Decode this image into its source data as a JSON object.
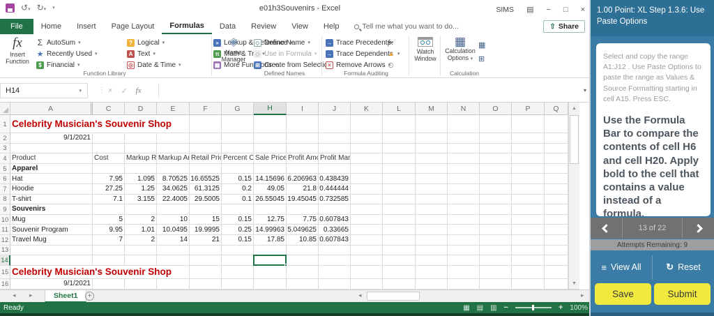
{
  "window": {
    "title": "e01h3Souvenirs - Excel",
    "user": "SIMS"
  },
  "menu": {
    "tabs": [
      "File",
      "Home",
      "Insert",
      "Page Layout",
      "Formulas",
      "Data",
      "Review",
      "View",
      "Help"
    ],
    "active_tab": "Formulas",
    "tell_me": "Tell me what you want to do...",
    "share": "Share"
  },
  "ribbon": {
    "insert_function": "Insert Function",
    "autosum": "AutoSum",
    "recently_used": "Recently Used",
    "financial": "Financial",
    "logical": "Logical",
    "text": "Text",
    "date_time": "Date & Time",
    "lookup": "Lookup & Reference",
    "math_trig": "Math & Trig",
    "more_functions": "More Functions",
    "name_manager": "Name Manager",
    "define_name": "Define Name",
    "use_in_formula": "Use in Formula",
    "create_from_selection": "Create from Selection",
    "trace_precedents": "Trace Precedents",
    "trace_dependents": "Trace Dependents",
    "remove_arrows": "Remove Arrows",
    "watch_window": "Watch Window",
    "calculation_options": "Calculation Options",
    "groups": {
      "function_library": "Function Library",
      "defined_names": "Defined Names",
      "formula_auditing": "Formula Auditing",
      "calculation": "Calculation"
    }
  },
  "formula_bar": {
    "name_box": "H14",
    "formula": ""
  },
  "sheet": {
    "columns": [
      "A",
      "C",
      "D",
      "E",
      "F",
      "G",
      "H",
      "I",
      "J",
      "K",
      "L",
      "M",
      "N",
      "O",
      "P",
      "Q"
    ],
    "selected_cell": "H14",
    "selected_column": "H",
    "selected_row": "14",
    "tab": "Sheet1",
    "rows": [
      {
        "num": "1",
        "type": "title",
        "cells": {
          "A": "Celebrity Musician's Souvenir Shop"
        }
      },
      {
        "num": "2",
        "type": "plain",
        "align_a": "right",
        "cells": {
          "A": "9/1/2021"
        }
      },
      {
        "num": "3",
        "type": "plain",
        "cells": {}
      },
      {
        "num": "4",
        "type": "colhead",
        "cells": {
          "A": "Product",
          "C": "Cost",
          "D": "Markup Rate",
          "E": "Markup Amount",
          "F": "Retail Price",
          "G": "Percent Off",
          "H": "Sale Price",
          "I": "Profit Amount",
          "J": "Profit Margin"
        }
      },
      {
        "num": "5",
        "type": "category",
        "cells": {
          "A": "Apparel"
        }
      },
      {
        "num": "6",
        "type": "data",
        "cells": {
          "A": "Hat",
          "C": "7.95",
          "D": "1.095",
          "E": "8.70525",
          "F": "16.65525",
          "G": "0.15",
          "H": "14.15696",
          "I": "6.206963",
          "J": "0.438439"
        }
      },
      {
        "num": "7",
        "type": "data",
        "cells": {
          "A": "Hoodie",
          "C": "27.25",
          "D": "1.25",
          "E": "34.0625",
          "F": "61.3125",
          "G": "0.2",
          "H": "49.05",
          "I": "21.8",
          "J": "0.444444"
        }
      },
      {
        "num": "8",
        "type": "data",
        "cells": {
          "A": "T-shirt",
          "C": "7.1",
          "D": "3.155",
          "E": "22.4005",
          "F": "29.5005",
          "G": "0.1",
          "H": "26.55045",
          "I": "19.45045",
          "J": "0.732585"
        }
      },
      {
        "num": "9",
        "type": "category",
        "cells": {
          "A": "Souvenirs"
        }
      },
      {
        "num": "10",
        "type": "data",
        "cells": {
          "A": "Mug",
          "C": "5",
          "D": "2",
          "E": "10",
          "F": "15",
          "G": "0.15",
          "H": "12.75",
          "I": "7.75",
          "J": "0.607843"
        }
      },
      {
        "num": "11",
        "type": "data",
        "cells": {
          "A": "Souvenir Program",
          "C": "9.95",
          "D": "1.01",
          "E": "10.0495",
          "F": "19.9995",
          "G": "0.25",
          "H": "14.99963",
          "I": "5.049625",
          "J": "0.33665"
        }
      },
      {
        "num": "12",
        "type": "data",
        "cells": {
          "A": "Travel Mug",
          "C": "7",
          "D": "2",
          "E": "14",
          "F": "21",
          "G": "0.15",
          "H": "17.85",
          "I": "10.85",
          "J": "0.607843"
        }
      },
      {
        "num": "13",
        "type": "plain",
        "cells": {}
      },
      {
        "num": "14",
        "type": "plain",
        "selected": "H",
        "cells": {}
      },
      {
        "num": "15",
        "type": "title",
        "cells": {
          "A": "Celebrity Musician's Souvenir Shop"
        }
      },
      {
        "num": "16",
        "type": "plain",
        "align_a": "right",
        "cells": {
          "A": "9/1/2021"
        }
      }
    ]
  },
  "status": {
    "ready": "Ready",
    "zoom": "100%"
  },
  "task_panel": {
    "header": "1.00 Point: XL Step 1.3.6: Use Paste Options",
    "instruction_1": "Select and copy the range A1:J12 . Use Paste Options to paste the range as Values & Source Formatting starting in cell A15. Press ESC.",
    "instruction_2": "Use the Formula Bar to compare the contents of cell H6 and cell H20. Apply bold to the cell that contains a value instead of a formula.",
    "pager": "13 of 22",
    "attempts": "Attempts Remaining: 9",
    "view_all": "View All",
    "reset": "Reset",
    "save": "Save",
    "submit": "Submit"
  },
  "colors": {
    "excel_green": "#217346",
    "title_red": "#C00000",
    "panel_teal": "#3A7CA6",
    "panel_header_teal": "#2E7095",
    "button_yellow": "#F2E93F",
    "selection_green": "#217346"
  }
}
